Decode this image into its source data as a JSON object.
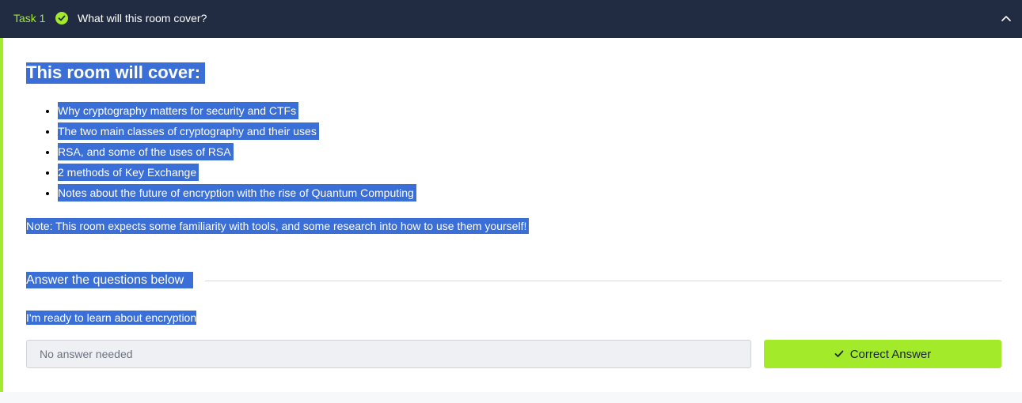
{
  "task": {
    "number_label": "Task 1",
    "title": "What will this room cover?",
    "status_icon": "check-circle-icon",
    "collapse_icon": "chevron-up-icon"
  },
  "content": {
    "heading": "This room will cover:",
    "items": [
      "Why cryptography matters for security and CTFs",
      "The two main classes of cryptography and their uses",
      "RSA, and some of the uses of RSA",
      "2 methods of Key Exchange",
      "Notes about the future of encryption with the rise of Quantum Computing"
    ],
    "note": "Note: This room expects some familiarity with tools, and some research into how to use them yourself!"
  },
  "answers": {
    "section_title": "Answer the questions below",
    "question": "I'm ready to learn about encryption",
    "input_placeholder": "No answer needed",
    "submit_label": "Correct Answer",
    "submit_icon": "check-icon"
  },
  "colors": {
    "header_bg": "#212c42",
    "accent": "#a3ea2a",
    "selection": "#3a6fd8"
  }
}
